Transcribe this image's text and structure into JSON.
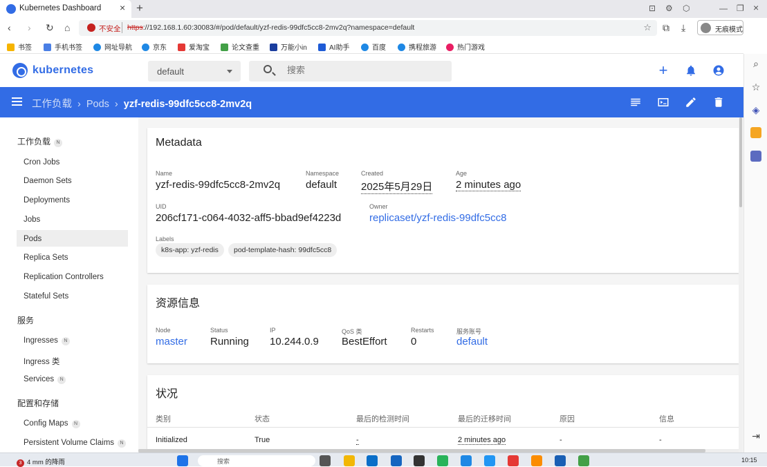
{
  "browser": {
    "tab_title": "Kubernetes Dashboard",
    "insecure_label": "不安全",
    "url_scheme": "https",
    "url_rest": "://192.168.1.60:30083/#/pod/default/yzf-redis-99dfc5cc8-2mv2q?namespace=default",
    "profile_label": "无痕模式",
    "bookmarks": [
      "书签",
      "手机书签",
      "网址导航",
      "京东",
      "爱淘宝",
      "论文查重",
      "万能小in",
      "AI助手",
      "百度",
      "携程旅游",
      "热门游戏"
    ]
  },
  "header": {
    "app_name": "kubernetes",
    "namespace": "default",
    "search_placeholder": "搜索"
  },
  "toolbar": {
    "crumb_1": "工作负载",
    "crumb_2": "Pods",
    "crumb_current": "yzf-redis-99dfc5cc8-2mv2q"
  },
  "sidebar": {
    "workloads_head": "工作负载",
    "badge": "N",
    "workloads": [
      "Cron Jobs",
      "Daemon Sets",
      "Deployments",
      "Jobs",
      "Pods",
      "Replica Sets",
      "Replication Controllers",
      "Stateful Sets"
    ],
    "service_head": "服务",
    "services": [
      "Ingresses",
      "Ingress 类",
      "Services"
    ],
    "config_head": "配置和存储",
    "config": [
      "Config Maps",
      "Persistent Volume Claims"
    ]
  },
  "metadata": {
    "title": "Metadata",
    "name_label": "Name",
    "name": "yzf-redis-99dfc5cc8-2mv2q",
    "namespace_label": "Namespace",
    "namespace": "default",
    "created_label": "Created",
    "created": "2025年5月29日",
    "age_label": "Age",
    "age": "2 minutes ago",
    "uid_label": "UID",
    "uid": "206cf171-c064-4032-aff5-bbad9ef4223d",
    "owner_label": "Owner",
    "owner": "replicaset/yzf-redis-99dfc5cc8",
    "labels_label": "Labels",
    "labels": [
      "k8s-app: yzf-redis",
      "pod-template-hash: 99dfc5cc8"
    ]
  },
  "resource": {
    "title": "资源信息",
    "node_label": "Node",
    "node": "master",
    "status_label": "Status",
    "status": "Running",
    "ip_label": "IP",
    "ip": "10.244.0.9",
    "qos_label": "QoS 类",
    "qos": "BestEffort",
    "restarts_label": "Restarts",
    "restarts": "0",
    "sa_label": "服务账号",
    "sa": "default"
  },
  "conditions": {
    "title": "状况",
    "headers": [
      "类别",
      "状态",
      "最后的检测时间",
      "最后的迁移时间",
      "原因",
      "信息"
    ],
    "rows": [
      [
        "Initialized",
        "True",
        "-",
        "2 minutes ago",
        "-",
        "-"
      ]
    ]
  },
  "taskbar": {
    "weather_count": "3",
    "weather": "4 mm 的降雨",
    "search": "搜索",
    "clock": "10:15"
  },
  "colors": {
    "brand": "#326ce5",
    "warning": "#c5221f"
  }
}
